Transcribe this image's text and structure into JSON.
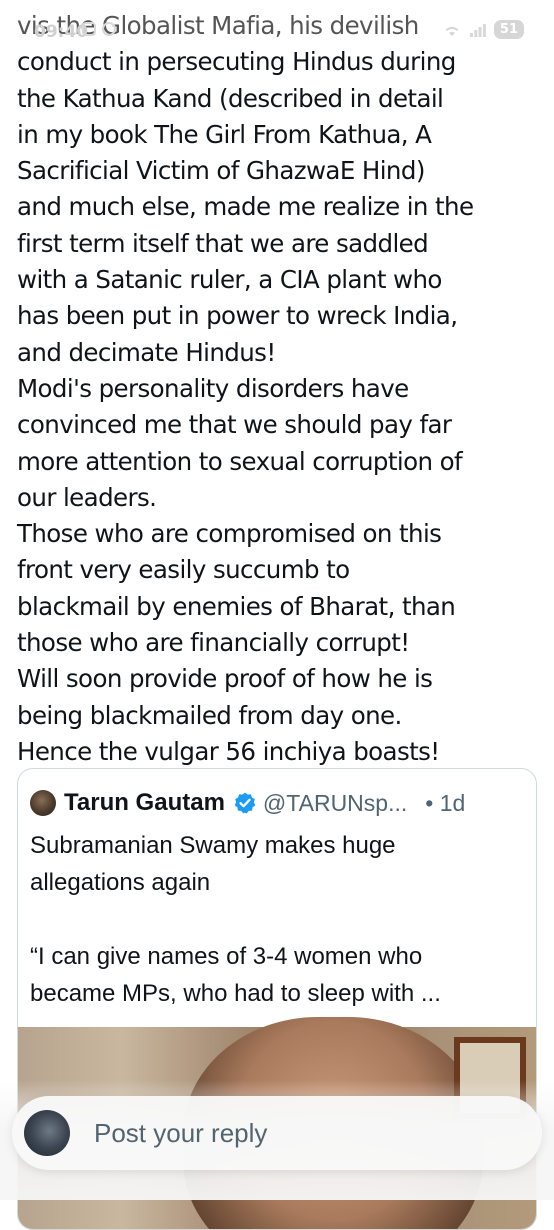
{
  "status_bar": {
    "time": "09:40",
    "battery": "51"
  },
  "tweet": {
    "lines": [
      "vis the Globalist Mafia, his devilish",
      "conduct in persecuting Hindus during",
      "the Kathua Kand (described in detail",
      "in my book The Girl From Kathua, A",
      "Sacrificial Victim of GhazwaE Hind)",
      "and much else, made me realize in the",
      "first term itself that we are saddled",
      "with a Satanic ruler, a CIA plant who",
      "has been put in power to wreck India,",
      "and decimate Hindus!",
      "Modi's personality disorders have",
      "convinced me that we should pay far",
      "more attention to sexual corruption of",
      "our leaders.",
      "Those who are compromised on this",
      "front very easily succumb to",
      "blackmail by enemies of Bharat, than",
      "those who are financially corrupt!",
      "Will soon provide proof of how he is",
      "being blackmailed from day one.",
      "Hence the vulgar 56 inchiya boasts!"
    ]
  },
  "quote": {
    "author_name": "Tarun Gautam",
    "author_handle": "@TARUNsp...",
    "time": "• 1d",
    "text_lines": [
      "Subramanian Swamy makes huge",
      "allegations again",
      "",
      "“I can give names of 3-4 women who",
      "became MPs, who had to sleep with ..."
    ]
  },
  "reply": {
    "placeholder": "Post your reply"
  },
  "icons": {
    "verified": "verified-badge-icon",
    "wifi": "wifi-icon",
    "signal": "signal-icon"
  },
  "colors": {
    "verified_blue": "#1d9bf0",
    "secondary_text": "#536471",
    "primary_text": "#0f1419"
  }
}
